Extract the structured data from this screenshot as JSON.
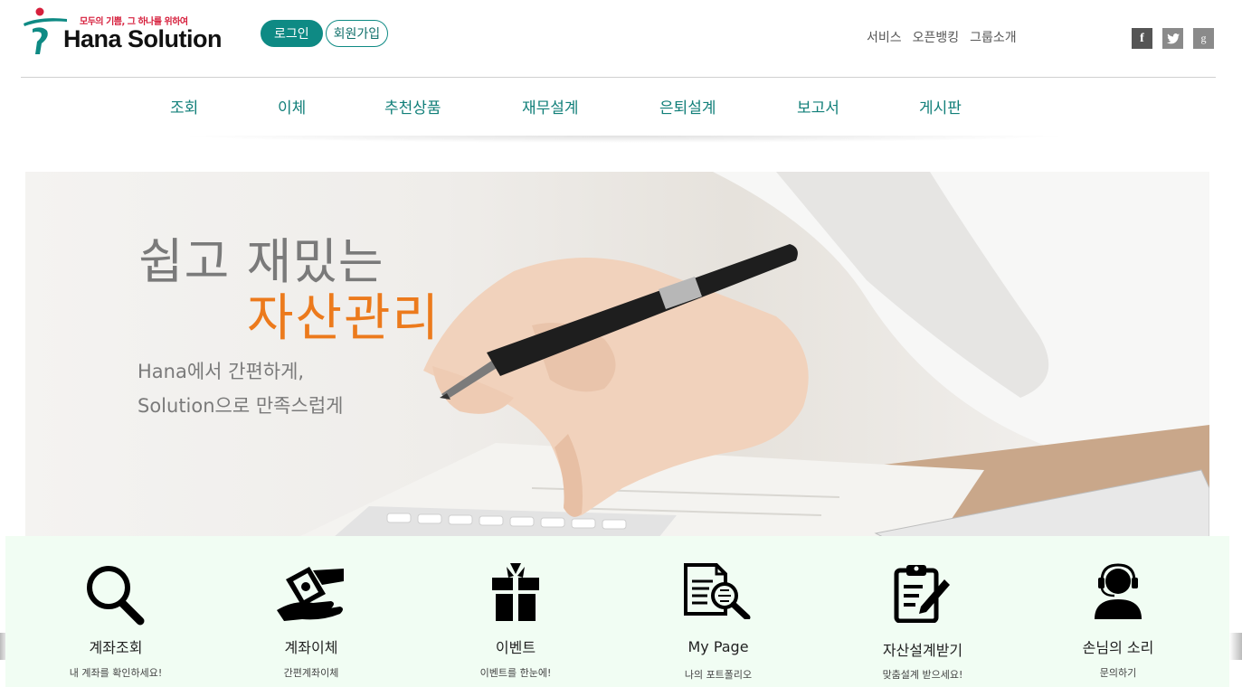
{
  "header": {
    "logo_tagline": "모두의 기쁨, 그 하나를 위하여",
    "logo_name": "Hana Solution",
    "login_label": "로그인",
    "join_label": "회원가입",
    "util_links": [
      "서비스",
      "오픈뱅킹",
      "그룹소개"
    ],
    "social": [
      {
        "icon": "facebook-icon",
        "glyph": "f"
      },
      {
        "icon": "twitter-icon",
        "glyph": "t"
      },
      {
        "icon": "google-plus-icon",
        "glyph": "g"
      }
    ]
  },
  "nav": {
    "items": [
      "조회",
      "이체",
      "추천상품",
      "재무설계",
      "은퇴설계",
      "보고서",
      "게시판"
    ]
  },
  "hero": {
    "title_line1": "쉽고 재밌는",
    "title_line2": "자산관리",
    "sub_line1": "Hana에서 간편하게,",
    "sub_line2": "Solution으로 만족스럽게",
    "accent_color": "#ec7a1c"
  },
  "quick_menu": [
    {
      "icon": "search-icon",
      "title": "계좌조회",
      "subtitle": "내 계좌를 확인하세요!"
    },
    {
      "icon": "money-transfer-icon",
      "title": "계좌이체",
      "subtitle": "간편계좌이체"
    },
    {
      "icon": "gift-icon",
      "title": "이벤트",
      "subtitle": "이벤트를 한눈에!"
    },
    {
      "icon": "document-search-icon",
      "title": "My Page",
      "subtitle": "나의 포트폴리오"
    },
    {
      "icon": "clipboard-edit-icon",
      "title": "자산설계받기",
      "subtitle": "맞춤설계 받으세요!"
    },
    {
      "icon": "customer-support-icon",
      "title": "손님의 소리",
      "subtitle": "문의하기"
    }
  ],
  "colors": {
    "brand_teal": "#0e8a84",
    "nav_text": "#117f79",
    "quick_bg": "#f1fdf3"
  }
}
